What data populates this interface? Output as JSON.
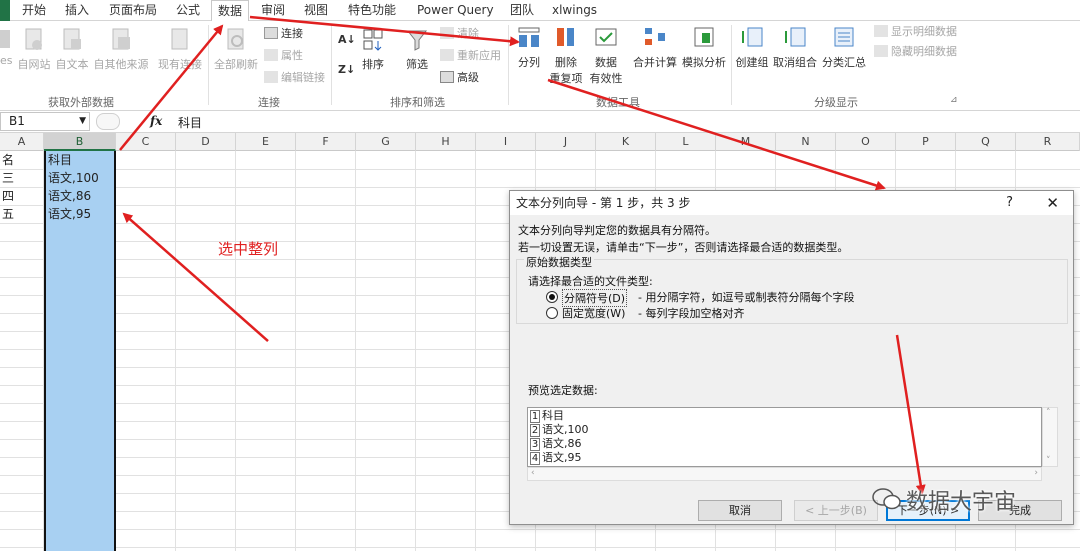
{
  "tabs": [
    "开始",
    "插入",
    "页面布局",
    "公式",
    "数据",
    "审阅",
    "视图",
    "特色功能",
    "Power Query",
    "团队",
    "xlwings"
  ],
  "active_tab": "数据",
  "ribbon": {
    "ext_data": {
      "b1": "ess",
      "b2": "自网站",
      "b3": "自文本",
      "b4": "自其他来源",
      "b5": "现有连接",
      "group": "获取外部数据"
    },
    "connections": {
      "refresh": "全部刷新",
      "connect": "连接",
      "props": "属性",
      "edit": "编辑链接",
      "group": "连接"
    },
    "sort": {
      "sort": "排序",
      "filter": "筛选",
      "clear": "清除",
      "reapply": "重新应用",
      "advanced": "高级",
      "group": "排序和筛选"
    },
    "tools": {
      "split": "分列",
      "remove": "删除",
      "remove2": "重复项",
      "valid": "数据",
      "valid2": "有效性",
      "consolidate": "合并计算",
      "whatif": "模拟分析",
      "group": "数据工具"
    },
    "outline": {
      "group_btn": "创建组",
      "ungroup": "取消组合",
      "subtotal": "分类汇总",
      "show": "显示明细数据",
      "hide": "隐藏明细数据",
      "group": "分级显示"
    }
  },
  "formula_bar": {
    "name_box": "B1",
    "fx": "fx",
    "formula": "科目"
  },
  "columns": [
    "A",
    "B",
    "C",
    "D",
    "E",
    "F",
    "G",
    "H",
    "I",
    "J",
    "K",
    "L",
    "M",
    "N",
    "O",
    "P",
    "Q",
    "R"
  ],
  "sheet": {
    "a_col": [
      "名",
      "三",
      "四",
      "五"
    ],
    "b_col": [
      "科目",
      "语文,100",
      "语文,86",
      "语文,95"
    ]
  },
  "annotation": "选中整列",
  "dialog": {
    "title": "文本分列向导 - 第 1 步，共 3 步",
    "help": "?",
    "close": "✕",
    "line1": "文本分列向导判定您的数据具有分隔符。",
    "line2": "若一切设置无误，请单击“下一步”，否则请选择最合适的数据类型。",
    "group_title": "原始数据类型",
    "prompt": "请选择最合适的文件类型:",
    "opt1_label": "分隔符号(D)",
    "opt1_desc": "- 用分隔字符，如逗号或制表符分隔每个字段",
    "opt2_label": "固定宽度(W)",
    "opt2_desc": "- 每列字段加空格对齐",
    "preview_label": "预览选定数据:",
    "preview_nums": [
      "1",
      "2",
      "3",
      "4"
    ],
    "preview_lines": [
      "科目",
      "语文,100",
      "语文,86",
      "语文,95"
    ],
    "btn_cancel": "取消",
    "btn_prev": "< 上一步(B)",
    "btn_next": "下一步(N) >",
    "btn_finish": "完成"
  },
  "watermark": "数据大宇宙",
  "colors": {
    "excel_green": "#217346",
    "selection_fill": "#a8d0f2",
    "annotation_red": "#e02020"
  }
}
